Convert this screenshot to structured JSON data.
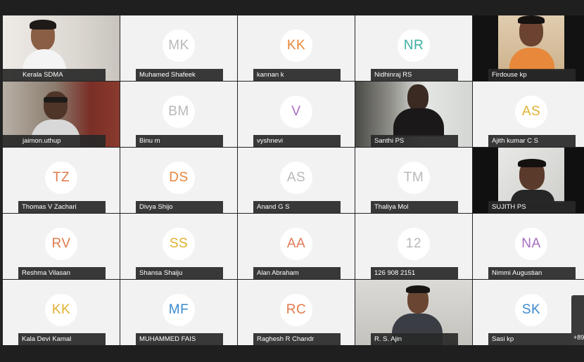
{
  "participants": [
    {
      "name": "Kerala SDMA",
      "initials": "",
      "video": true,
      "color": ""
    },
    {
      "name": "Muhamed Shafeek",
      "initials": "MK",
      "video": false,
      "color": "#b8b8b8"
    },
    {
      "name": "kannan k",
      "initials": "KK",
      "video": false,
      "color": "#e8863a"
    },
    {
      "name": "Nidhinraj RS",
      "initials": "NR",
      "video": false,
      "color": "#3ab0a0"
    },
    {
      "name": "Firdouse kp",
      "initials": "",
      "video": true,
      "color": ""
    },
    {
      "name": "jaimon.uthup",
      "initials": "",
      "video": true,
      "color": ""
    },
    {
      "name": "Binu m",
      "initials": "BM",
      "video": false,
      "color": "#b8b8b8"
    },
    {
      "name": "vyshnevi",
      "initials": "V",
      "video": false,
      "color": "#a66cc0"
    },
    {
      "name": "Santhi PS",
      "initials": "",
      "video": true,
      "color": ""
    },
    {
      "name": "Ajith kumar C S",
      "initials": "AS",
      "video": false,
      "color": "#e0b030"
    },
    {
      "name": "Thomas V Zachari",
      "initials": "TZ",
      "video": false,
      "color": "#e07a4a"
    },
    {
      "name": "Divya Shijo",
      "initials": "DS",
      "video": false,
      "color": "#e8863a"
    },
    {
      "name": "Anand G S",
      "initials": "AS",
      "video": false,
      "color": "#b8b8b8"
    },
    {
      "name": "Thaliya Mol",
      "initials": "TM",
      "video": false,
      "color": "#b8b8b8"
    },
    {
      "name": "SUJITH PS",
      "initials": "",
      "video": true,
      "color": ""
    },
    {
      "name": "Reshma Vilasan",
      "initials": "RV",
      "video": false,
      "color": "#e07a4a"
    },
    {
      "name": "Shansa Shaiju",
      "initials": "SS",
      "video": false,
      "color": "#e0b030"
    },
    {
      "name": "Alan Abraham",
      "initials": "AA",
      "video": false,
      "color": "#e07a5a"
    },
    {
      "name": "126 908 2151",
      "initials": "12",
      "video": false,
      "color": "#b8b8b8"
    },
    {
      "name": "Nimmi Augustian",
      "initials": "NA",
      "video": false,
      "color": "#a66cc0"
    },
    {
      "name": "Kala Devi Kamal",
      "initials": "KK",
      "video": false,
      "color": "#e0b030"
    },
    {
      "name": "MUHAMMED FAIS",
      "initials": "MF",
      "video": false,
      "color": "#3a8ad0"
    },
    {
      "name": "Raghesh R Chandr",
      "initials": "RC",
      "video": false,
      "color": "#e07a4a"
    },
    {
      "name": "R. S. Ajin",
      "initials": "",
      "video": true,
      "color": ""
    },
    {
      "name": "Sasi kp",
      "initials": "SK",
      "video": false,
      "color": "#3a8ad0"
    }
  ],
  "overflow_label": "+89"
}
